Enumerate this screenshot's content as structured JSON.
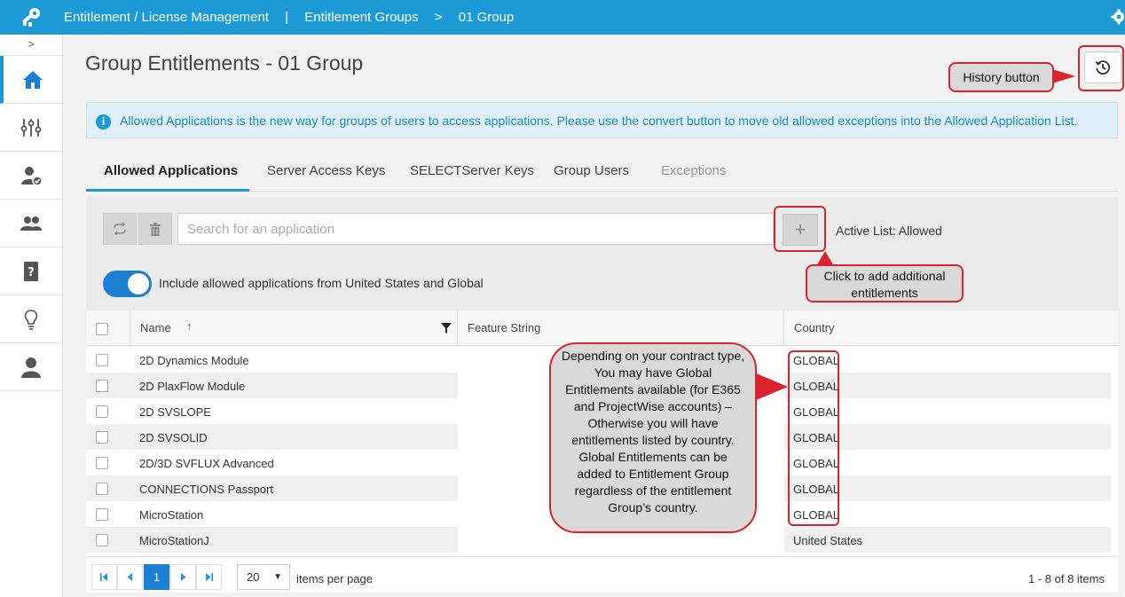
{
  "header": {
    "app_name": "Entitlement / License Management",
    "separator": "|",
    "crumb_groups": "Entitlement Groups",
    "crumb_arrow": ">",
    "crumb_current": "01 Group"
  },
  "sidebar": {
    "expand_label": ">",
    "items": [
      "home",
      "settings-sliders",
      "user-check",
      "users",
      "help-book",
      "lightbulb",
      "profile"
    ]
  },
  "page": {
    "title": "Group Entitlements - 01 Group"
  },
  "info": {
    "icon_text": "i",
    "message": "Allowed Applications is the new way for groups of users to access applications. Please use the convert button to move old allowed exceptions into the Allowed Application List."
  },
  "tabs": [
    {
      "label": "Allowed Applications",
      "state": "active"
    },
    {
      "label": "Server Access Keys",
      "state": "normal"
    },
    {
      "label": "SELECTServer Keys",
      "state": "normal"
    },
    {
      "label": "Group Users",
      "state": "normal"
    },
    {
      "label": "Exceptions",
      "state": "disabled"
    }
  ],
  "toolbar": {
    "search_placeholder": "Search for an application",
    "add_label": "+",
    "active_list": "Active List: Allowed"
  },
  "toggle": {
    "on": true,
    "label": "Include allowed applications from United States and Global"
  },
  "grid": {
    "columns": {
      "name": "Name",
      "sort_indicator": "↑",
      "feature": "Feature String",
      "country": "Country"
    },
    "rows": [
      {
        "name": "2D Dynamics Module",
        "feature": "",
        "country": "GLOBAL"
      },
      {
        "name": "2D PlaxFlow Module",
        "feature": "",
        "country": "GLOBAL"
      },
      {
        "name": "2D SVSLOPE",
        "feature": "",
        "country": "GLOBAL"
      },
      {
        "name": "2D SVSOLID",
        "feature": "",
        "country": "GLOBAL"
      },
      {
        "name": "2D/3D SVFLUX Advanced",
        "feature": "",
        "country": "GLOBAL"
      },
      {
        "name": "CONNECTIONS Passport",
        "feature": "",
        "country": "GLOBAL"
      },
      {
        "name": "MicroStation",
        "feature": "",
        "country": "GLOBAL"
      },
      {
        "name": "MicroStationJ",
        "feature": "",
        "country": "United States"
      }
    ]
  },
  "pager": {
    "current_page": "1",
    "page_size": "20",
    "page_size_arrow": "▼",
    "per_page_label": "items per page",
    "summary": "1 - 8 of 8 items"
  },
  "annotations": {
    "history": "History button",
    "add": "Click to add additional entitlements",
    "country": "Depending on your contract type, You may have Global Entitlements available (for E365 and ProjectWise accounts) – Otherwise you will have entitlements listed by country. Global Entitlements can be added to Entitlement Group regardless of the entitlement Group’s country."
  },
  "colors": {
    "header": "#1b9ad6",
    "accent": "#1b7fd3",
    "callout_border": "#d9232d",
    "callout_fill": "#d9d9d9"
  }
}
